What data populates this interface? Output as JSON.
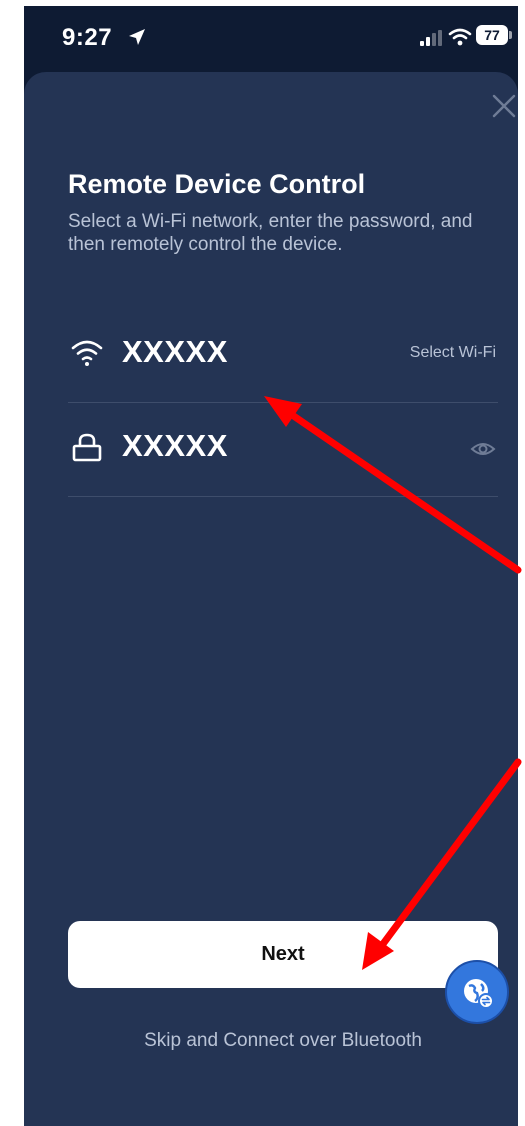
{
  "status_bar": {
    "time": "9:27",
    "battery": "77"
  },
  "sheet": {
    "title": "Remote Device Control",
    "subtitle": "Select a Wi-Fi network, enter the password, and then remotely control the device.",
    "wifi_row": {
      "icon": "wifi-icon",
      "value": "XXXXX",
      "action_label": "Select Wi-Fi"
    },
    "password_row": {
      "icon": "lock-icon",
      "value": "XXXXX",
      "toggle_icon": "eye-icon"
    },
    "next_label": "Next",
    "skip_label": "Skip and Connect over Bluetooth"
  },
  "colors": {
    "status_bg": "#0e1b33",
    "sheet_bg": "#243454",
    "annotation_arrow": "#ff0000",
    "help_button": "#3377dd"
  }
}
